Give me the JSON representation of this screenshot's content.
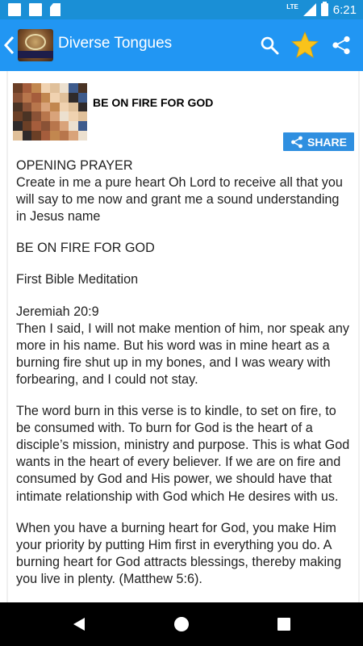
{
  "status_bar": {
    "network": "LTE",
    "time": "6:21",
    "icons": [
      "notification-icon",
      "notification-icon",
      "sd-card-icon",
      "signal-icon",
      "battery-icon"
    ]
  },
  "app_bar": {
    "title": "Diverse Tongues",
    "back_icon": "chevron-left-icon",
    "logo_icon": "app-logo",
    "actions": [
      "search-icon",
      "star-icon",
      "share-icon"
    ],
    "colors": {
      "bar": "#2196f3",
      "star": "#f9c31b"
    }
  },
  "post": {
    "title": "BE ON FIRE FOR GOD",
    "share_label": "SHARE",
    "share_color": "#2f8fe0",
    "paragraphs": [
      [
        "OPENING PRAYER",
        "Create in me a pure heart Oh Lord to receive all that you will say to me now and grant me a sound understanding in Jesus name"
      ],
      [
        "BE ON FIRE FOR GOD"
      ],
      [
        "First Bible Meditation"
      ],
      [
        "Jeremiah 20:9",
        "Then I said, I will not make mention of him, nor speak any more in his name. But his word was in mine heart as a burning fire shut up in my bones, and I was weary with forbearing, and I could not stay."
      ],
      [
        "The word burn in this verse is to kindle, to set on fire, to be consumed with. To burn for God is the heart of a disciple’s mission, ministry and purpose. This is what God wants in the heart of every believer. If we are on fire and consumed by God and His power, we should have that intimate relationship with God which He desires with us."
      ],
      [
        "When you have a burning heart for God, you make Him your priority by putting Him first in everything you do. A burning heart for God attracts blessings, thereby making you live in plenty. (Matthew 5:6)."
      ]
    ]
  },
  "nav_bar": {
    "buttons": [
      "back-triangle-icon",
      "home-circle-icon",
      "recents-square-icon"
    ]
  }
}
